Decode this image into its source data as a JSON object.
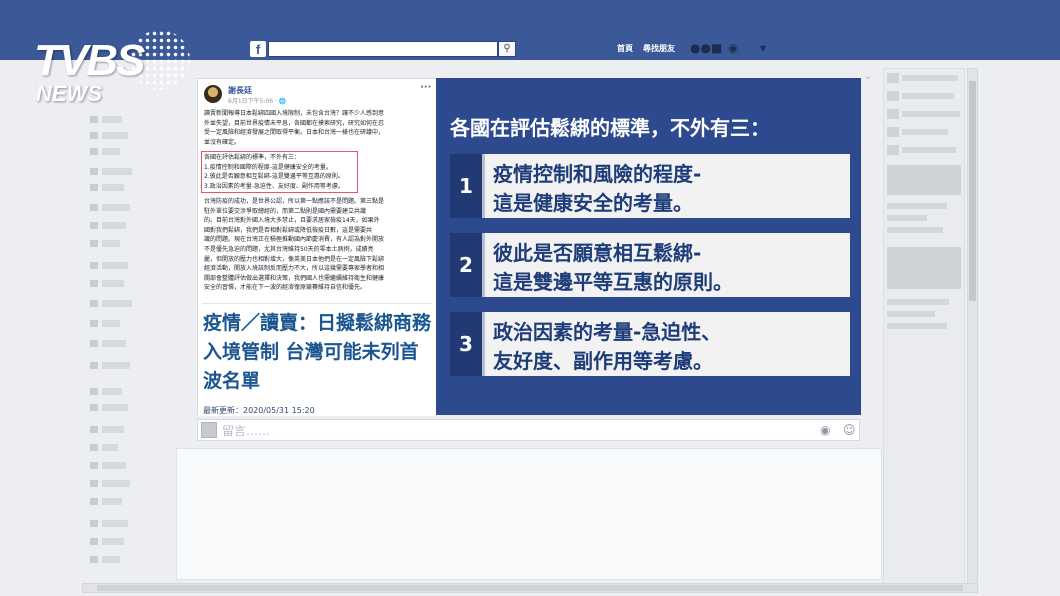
{
  "fb": {
    "logo": "f",
    "nav": [
      "首頁",
      "尋找朋友"
    ],
    "icons": [
      "friends-icon",
      "messages-icon",
      "notifications-icon",
      "settings-icon"
    ]
  },
  "watermark": {
    "brand": "TVBS",
    "sub": "NEWS"
  },
  "post": {
    "author": "謝長廷",
    "time": "6月1日下午5:06 · 🌐",
    "intro": [
      "讀賣新聞報導日本鬆綁四國入境限制，未包含台灣？讓不少人感到意",
      "外並失望，目前世界疫情未平息，各國都在摸索研究，研究如何在忍",
      "受一定風險和經濟發展之間取得平衡。日本和台灣一樣也在研議中，",
      "並沒有確定。"
    ],
    "criteria": [
      "各國在評估鬆綁的標準，不外有三：",
      "1.疫情控制和國際的程度-這是健康安全的考量。",
      "2.彼此是否願意相互鬆綁-這是雙邊平等互惠的原則。",
      "3.政治因素的考量-急迫性、友好度、副作用等考慮。"
    ],
    "body": [
      "台灣防疫的成功，是世界公認，所以第一點應該不是問題。第三點是",
      "駐外單位要交涉爭取總經的，而第二點則是國內需要建立共識",
      "的。目前台灣對外國入境大多禁止，且要求居家檢疫14天，如果外",
      "國對我們鬆綁，我們是否相對鬆綁或降低檢疫日數，這是需要共",
      "識的問題。現在台灣正在積極推動國內節慶消費，有人認為對外開放",
      "不是優先急迫的問題，尤其台灣維持50天的零本土病例，成績亮",
      "麗，但開放的壓力也相對增大，像英美日本他們是在一定風險下鬆綁",
      "經濟活動，開放入境該制反而壓力不大，所以這幾需要專家學者和相",
      "關部會整體評估做出選擇和決策，我們國人也需繼續維持衛生和健康",
      "安全的習慣，才能在下一波的經濟復原競賽維持自信和優先。"
    ]
  },
  "news": {
    "title": "疫情／讀賣：日擬鬆綁商務入境管制 台灣可能未列首波名單",
    "updated": "最新更新：2020/05/31 15:20"
  },
  "infographic": {
    "title": "各國在評估鬆綁的標準，不外有三：",
    "items": [
      {
        "num": "1",
        "line1": "疫情控制和風險的程度-",
        "line2": "這是健康安全的考量。"
      },
      {
        "num": "2",
        "line1": "彼此是否願意相互鬆綁-",
        "line2": "這是雙邊平等互惠的原則。"
      },
      {
        "num": "3",
        "line1": "政治因素的考量-急迫性、",
        "line2": "友好度、副作用等考慮。"
      }
    ]
  },
  "comment": {
    "placeholder": "留言……"
  },
  "colors": {
    "fb_blue": "#3b5998",
    "info_blue": "#2e4a8e",
    "news_blue": "#1c5691",
    "highlight": "#e05a6a"
  }
}
